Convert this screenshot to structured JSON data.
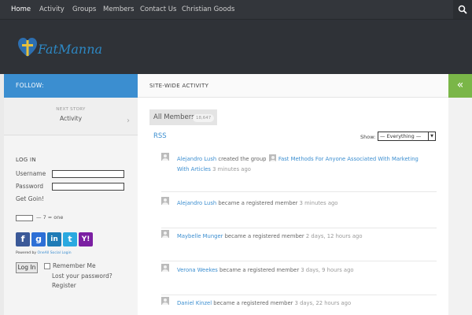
{
  "nav": {
    "items": [
      "Home",
      "Activity",
      "Groups",
      "Members",
      "Contact Us",
      "Christian Goods"
    ],
    "active": "Home"
  },
  "header": {
    "logo_text": "FatManna"
  },
  "follow_label": "FOLLOW:",
  "next_story": {
    "label": "NEXT STORY",
    "title": "Activity"
  },
  "login": {
    "heading": "LOG IN",
    "username_label": "Username",
    "password_label": "Password",
    "get_going": "Get Goin!",
    "captcha": "— 7 = one",
    "powered_prefix": "Powered by",
    "powered_link": "OneAll Social Login",
    "login_button": "Log In",
    "remember_me": "Remember Me",
    "lost_password": "Lost your password?",
    "register": "Register"
  },
  "social": [
    {
      "icon": "facebook-icon",
      "glyph": "f",
      "color": "#3b5998"
    },
    {
      "icon": "google-icon",
      "glyph": "g",
      "color": "#2d6fd6"
    },
    {
      "icon": "linkedin-icon",
      "glyph": "in",
      "color": "#1f7bb6"
    },
    {
      "icon": "twitter-icon",
      "glyph": "t",
      "color": "#2aa9e0"
    },
    {
      "icon": "yahoo-icon",
      "glyph": "Y!",
      "color": "#7b1fa2"
    }
  ],
  "main": {
    "heading": "SITE-WIDE ACTIVITY",
    "members_tab": "All Members",
    "members_count": "18,647",
    "rss": "RSS",
    "show_label": "Show:",
    "show_value": "— Everything —",
    "activities": [
      {
        "user": "Alejandro Lush",
        "action": "created the group",
        "group": "Fast Methods For Anyone Associated With Marketing With Articles",
        "time": "3 minutes ago"
      },
      {
        "user": "Alejandro Lush",
        "action": "became a registered member",
        "group": "",
        "time": "3 minutes ago"
      },
      {
        "user": "Maybelle Munger",
        "action": "became a registered member",
        "group": "",
        "time": "2 days, 12 hours ago"
      },
      {
        "user": "Verona Weekes",
        "action": "became a registered member",
        "group": "",
        "time": "3 days, 9 hours ago"
      },
      {
        "user": "Daniel Kinzel",
        "action": "became a registered member",
        "group": "",
        "time": "3 days, 22 hours ago"
      }
    ]
  },
  "colors": {
    "accent": "#3b8ed0",
    "nav_bg": "#33363b",
    "header_bg": "#2f3237",
    "collapse": "#7ab648"
  }
}
